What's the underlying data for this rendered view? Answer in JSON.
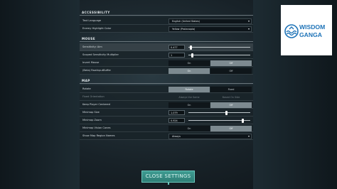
{
  "sections": {
    "accessibility": "ACCESSIBILITY",
    "mouse": "MOUSE",
    "map": "MAP"
  },
  "accessibility": {
    "text_language": {
      "label": "Text Language",
      "value": "English (United States)"
    },
    "enemy_highlight": {
      "label": "Enemy Highlight Color",
      "value": "Yellow (Protanopia)"
    }
  },
  "mouse": {
    "sensitivity_aim": {
      "label": "Sensitivity: Aim",
      "value": "0.477",
      "level": 0.04
    },
    "scoped_sensitivity": {
      "label": "Scoped Sensitivity Multiplier",
      "value": "1",
      "level": 0.06
    },
    "invert_mouse": {
      "label": "Invert Mouse",
      "option_a": "On",
      "option_b": "Off",
      "selected": "Off"
    },
    "raw_input": {
      "label": "(Beta) RawInputBuffer",
      "option_a": "On",
      "option_b": "Off",
      "selected": "On"
    }
  },
  "map": {
    "rotate": {
      "label": "Rotate",
      "option_a": "Rotate",
      "option_b": "Fixed",
      "selected": "Rotate"
    },
    "fixed_orientation": {
      "label": "Fixed Orientation",
      "option_a": "Always the Same",
      "option_b": "Based On Side"
    },
    "keep_player_centered": {
      "label": "Keep Player Centered",
      "option_a": "On",
      "option_b": "Off",
      "selected": "Off"
    },
    "minimap_size": {
      "label": "Minimap Size",
      "value": "1.079",
      "level": 0.62
    },
    "minimap_zoom": {
      "label": "Minimap Zoom",
      "value": "0.924",
      "level": 0.88
    },
    "vision_cones": {
      "label": "Minimap Vision Cones",
      "option_a": "On",
      "option_b": "Off",
      "selected": "Off"
    },
    "region_names": {
      "label": "Show Map Region Names",
      "value": "Always"
    }
  },
  "close_button": "CLOSE SETTINGS",
  "logo": {
    "line1": "WISDOM",
    "line2": "GANGA",
    "color": "#1f74b8"
  }
}
